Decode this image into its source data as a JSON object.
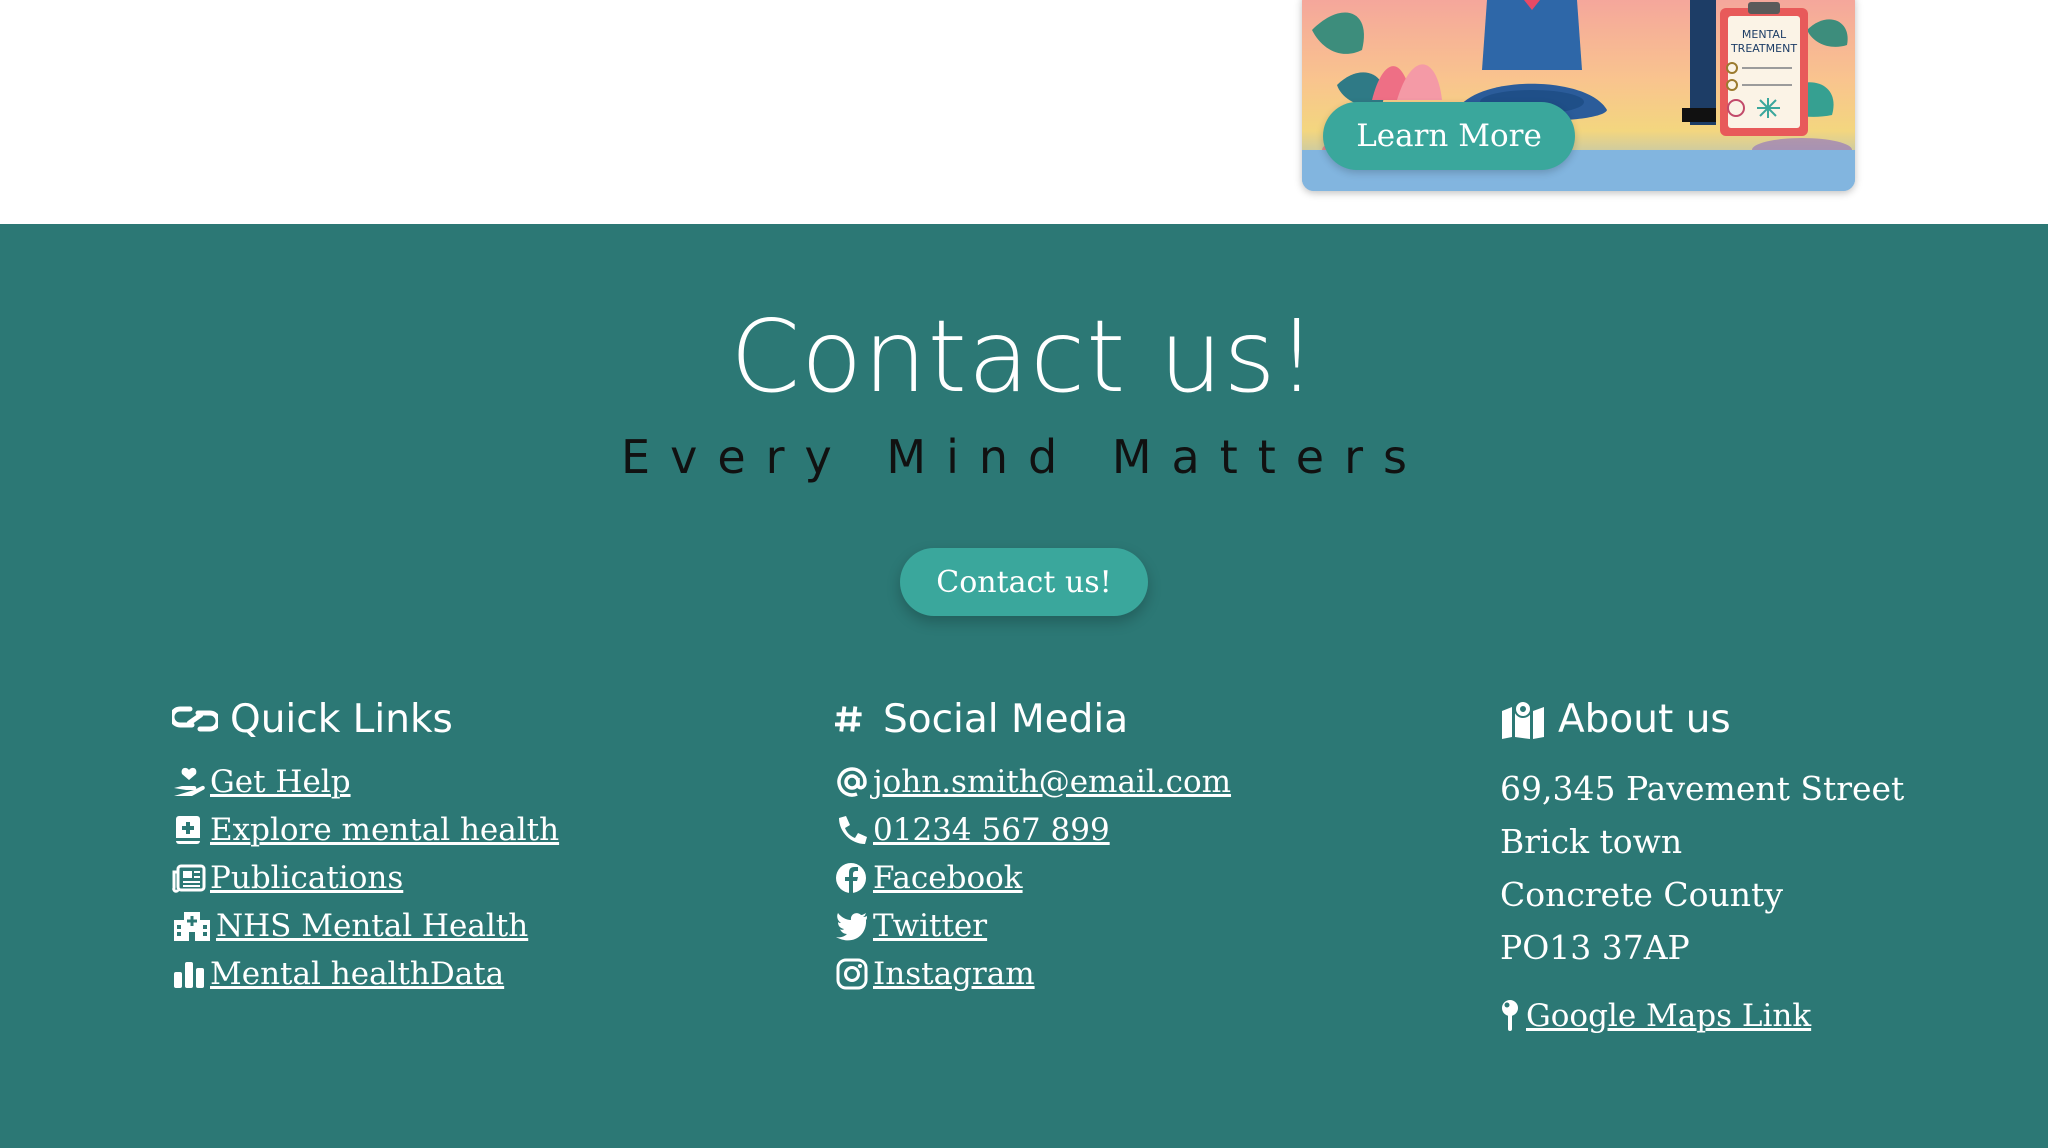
{
  "card": {
    "clipboard_label": "MENTAL TREATMENT",
    "button_label": "Learn More"
  },
  "footer": {
    "heading": "Contact us!",
    "tagline": "Every Mind Matters",
    "contact_button": "Contact us!",
    "quick_links": {
      "title": "Quick Links",
      "icon": "link-icon",
      "items": [
        {
          "label": " Get Help",
          "icon": "hand-holding-heart-icon"
        },
        {
          "label": " Explore mental health",
          "icon": "medical-book-icon"
        },
        {
          "label": " Publications",
          "icon": "newspaper-icon"
        },
        {
          "label": " NHS Mental Health",
          "icon": "hospital-icon"
        },
        {
          "label": " Mental healthData",
          "icon": "bar-chart-icon"
        }
      ]
    },
    "social_media": {
      "title": "Social Media",
      "icon": "hashtag-icon",
      "items": [
        {
          "label": "john.smith@email.com",
          "icon": "at-icon"
        },
        {
          "label": " 01234 567 899",
          "icon": "phone-icon"
        },
        {
          "label": " Facebook",
          "icon": "facebook-icon"
        },
        {
          "label": " Twitter",
          "icon": "twitter-icon"
        },
        {
          "label": " Instagram",
          "icon": "instagram-icon"
        }
      ]
    },
    "about_us": {
      "title": "About us",
      "icon": "map-icon",
      "address": [
        "69,345 Pavement Street",
        "Brick town",
        "Concrete County",
        "PO13 37AP"
      ],
      "maps_link": " Google Maps Link",
      "maps_icon": "map-pin-icon"
    }
  },
  "colors": {
    "footer_bg": "#2c7875",
    "button_bg": "#3aa79c",
    "tagline_text": "#111111",
    "text": "#ffffff"
  }
}
